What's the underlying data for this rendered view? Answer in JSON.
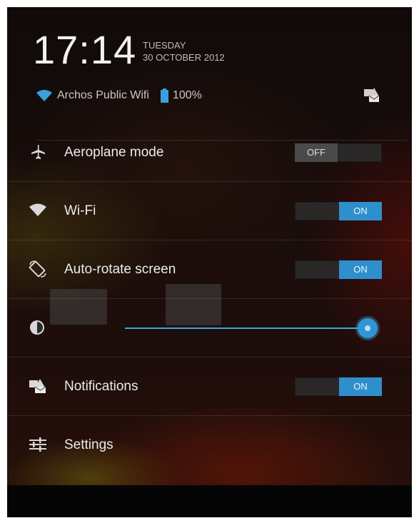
{
  "header": {
    "time": "17:14",
    "day": "TUESDAY",
    "date": "30 OCTOBER 2012",
    "network_name": "Archos Public Wifi",
    "battery_level": "100%",
    "notifications_icon": "notifications-icon"
  },
  "quick_settings": {
    "aeroplane_mode": {
      "label": "Aeroplane mode",
      "state": "OFF",
      "icon": "airplane-icon"
    },
    "wifi": {
      "label": "Wi-Fi",
      "state": "ON",
      "icon": "wifi-icon"
    },
    "auto_rotate": {
      "label": "Auto-rotate screen",
      "state": "ON",
      "icon": "rotate-icon"
    },
    "brightness": {
      "level": 1.0,
      "icon": "brightness-icon"
    },
    "notifications": {
      "label": "Notifications",
      "state": "ON",
      "icon": "notifications-icon"
    },
    "settings": {
      "label": "Settings",
      "icon": "settings-sliders-icon"
    }
  },
  "colors": {
    "accent": "#2f8fcc",
    "slider": "#3fa6e0",
    "text": "#ececec"
  }
}
